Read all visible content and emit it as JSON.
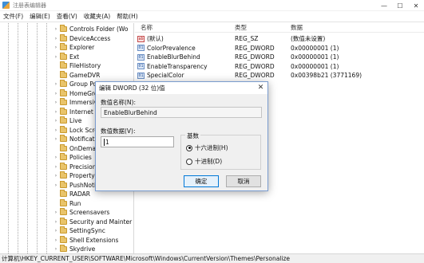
{
  "window": {
    "title": "注册表编辑器",
    "controls": {
      "minimize": "—",
      "maximize": "☐",
      "close": "✕"
    }
  },
  "menu": [
    "文件(F)",
    "编辑(E)",
    "查看(V)",
    "收藏夹(A)",
    "帮助(H)"
  ],
  "tree": {
    "items": [
      {
        "label": "Controls Folder (Wo",
        "expandable": true
      },
      {
        "label": "DeviceAccess",
        "expandable": true
      },
      {
        "label": "Explorer",
        "expandable": true
      },
      {
        "label": "Ext",
        "expandable": true
      },
      {
        "label": "FileHistory",
        "expandable": false
      },
      {
        "label": "GameDVR",
        "expandable": false
      },
      {
        "label": "Group Po",
        "expandable": true
      },
      {
        "label": "HomeGro",
        "expandable": true
      },
      {
        "label": "Immersiv",
        "expandable": true
      },
      {
        "label": "Internet S",
        "expandable": true
      },
      {
        "label": "Live",
        "expandable": true
      },
      {
        "label": "Lock Scre",
        "expandable": true
      },
      {
        "label": "Notificati",
        "expandable": true
      },
      {
        "label": "OnDema",
        "expandable": false
      },
      {
        "label": "Policies",
        "expandable": true
      },
      {
        "label": "Precision",
        "expandable": true
      },
      {
        "label": "PropertyS",
        "expandable": true
      },
      {
        "label": "PushNoti",
        "expandable": true
      },
      {
        "label": "RADAR",
        "expandable": false
      },
      {
        "label": "Run",
        "expandable": false
      },
      {
        "label": "Screensavers",
        "expandable": true
      },
      {
        "label": "Security and Mainter",
        "expandable": true
      },
      {
        "label": "SettingSync",
        "expandable": true
      },
      {
        "label": "Shell Extensions",
        "expandable": true
      },
      {
        "label": "Skydrive",
        "expandable": true
      }
    ]
  },
  "values": {
    "headers": {
      "name": "名称",
      "type": "类型",
      "data": "数据"
    },
    "rows": [
      {
        "icon": "string-value-icon",
        "icon_text": "ab",
        "name": "(默认)",
        "type": "REG_SZ",
        "data": "(数值未设置)"
      },
      {
        "icon": "dword-value-icon",
        "icon_text": "01",
        "name": "ColorPrevalence",
        "type": "REG_DWORD",
        "data": "0x00000001 (1)"
      },
      {
        "icon": "dword-value-icon",
        "icon_text": "01",
        "name": "EnableBlurBehind",
        "type": "REG_DWORD",
        "data": "0x00000001 (1)"
      },
      {
        "icon": "dword-value-icon",
        "icon_text": "01",
        "name": "EnableTransparency",
        "type": "REG_DWORD",
        "data": "0x00000001 (1)"
      },
      {
        "icon": "dword-value-icon",
        "icon_text": "01",
        "name": "SpecialColor",
        "type": "REG_DWORD",
        "data": "0x00398b21 (3771169)"
      }
    ]
  },
  "dialog": {
    "title": "编辑 DWORD (32 位)值",
    "close": "✕",
    "value_name_label": "数值名称(N):",
    "value_name": "EnableBlurBehind",
    "value_data_label": "数值数据(V):",
    "value_data": "1",
    "base_label": "基数",
    "base_options": [
      {
        "label": "十六进制(H)",
        "selected": true
      },
      {
        "label": "十进制(D)",
        "selected": false
      }
    ],
    "ok_label": "确定",
    "cancel_label": "取消"
  },
  "statusbar": {
    "path": "计算机\\HKEY_CURRENT_USER\\SOFTWARE\\Microsoft\\Windows\\CurrentVersion\\Themes\\Personalize"
  },
  "colors": {
    "dialog_border": "#7a9ccf",
    "default_button_border": "#0078d7",
    "folder": "#e9c46a"
  }
}
